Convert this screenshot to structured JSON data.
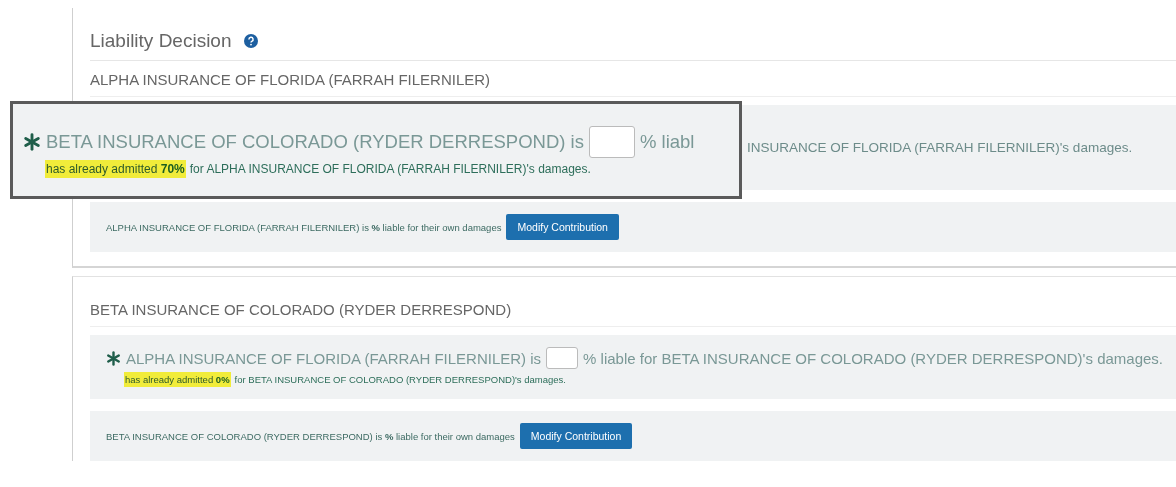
{
  "header": {
    "title": "Liability Decision"
  },
  "sections": [
    {
      "title": "ALPHA INSURANCE OF FLORIDA (FARRAH FILERNILER)",
      "claim": {
        "zoomed": true,
        "required": true,
        "party": "BETA INSURANCE OF COLORADO (RYDER DERRESPOND) is",
        "suffix": "% liabl",
        "behind_text": "INSURANCE OF FLORIDA (FARRAH FILERNILER)'s damages.",
        "admitted": "has already admitted **70%**",
        "admitted_rest": "for ALPHA INSURANCE OF FLORIDA (FARRAH FILERNILER)'s damages."
      },
      "own": {
        "text": "ALPHA INSURANCE OF FLORIDA (FARRAH FILERNILER) is **%** liable for their own damages",
        "button": "Modify Contribution"
      }
    },
    {
      "title": "BETA INSURANCE OF COLORADO (RYDER DERRESPOND)",
      "claim": {
        "zoomed": false,
        "required": true,
        "party": "ALPHA INSURANCE OF FLORIDA (FARRAH FILERNILER) is",
        "suffix": "% liable for BETA INSURANCE OF COLORADO (RYDER DERRESPOND)'s damages.",
        "admitted": "has already admitted **0%**",
        "admitted_rest": "for BETA INSURANCE OF COLORADO (RYDER DERRESPOND)'s damages."
      },
      "own": {
        "text": "BETA INSURANCE OF COLORADO (RYDER DERRESPOND) is **%** liable for their own damages",
        "button": "Modify Contribution"
      }
    }
  ]
}
